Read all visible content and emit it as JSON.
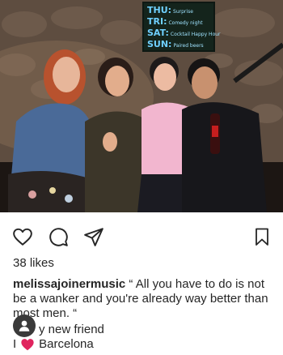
{
  "photo": {
    "chalkboard": [
      {
        "day": "THU:",
        "event": "Surprise"
      },
      {
        "day": "TRI:",
        "event": "Comedy night"
      },
      {
        "day": "SAT:",
        "event": "Cocktail Happy Hour"
      },
      {
        "day": "SUN:",
        "event": "Paired beers"
      }
    ]
  },
  "actions": {
    "like_icon": "heart-outline-icon",
    "comment_icon": "comment-bubble-icon",
    "share_icon": "paper-plane-icon",
    "save_icon": "bookmark-icon"
  },
  "post": {
    "likes": "38 likes",
    "username": "melissajoinermusic",
    "caption": " “ All you have to do is not be a wanker and you're already way better than most men. “",
    "line2_text": "y new friend",
    "line3_prefix": "I",
    "line3_suffix": "Barcelona"
  },
  "colors": {
    "text": "#262626",
    "heart": "#e0245e",
    "chalk": "#6fd0ff"
  }
}
